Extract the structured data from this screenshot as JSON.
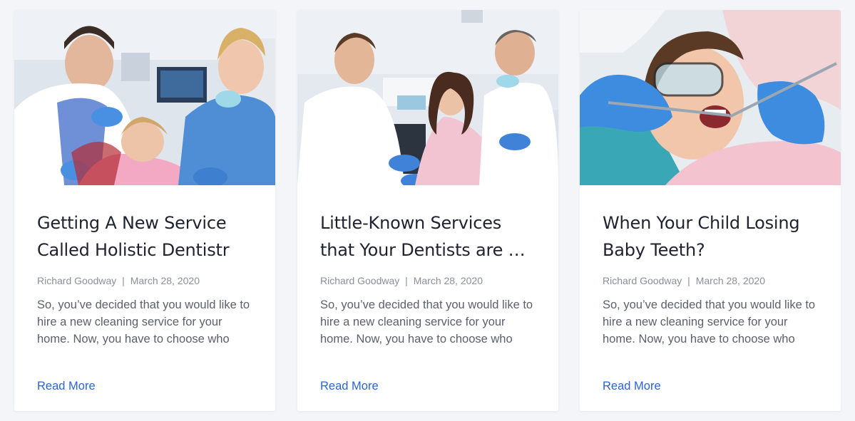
{
  "posts": [
    {
      "title": "Getting A New Service Called Holistic Dentistr",
      "author": "Richard Goodway",
      "date": "March 28, 2020",
      "excerpt": "So, you’ve decided that you would like to hire a new cleaning service for your home. Now, you have to choose who",
      "read_more": "Read More"
    },
    {
      "title": "Little-Known Services that Your Dentists are …",
      "author": "Richard Goodway",
      "date": "March 28, 2020",
      "excerpt": "So, you’ve decided that you would like to hire a new cleaning service for your home. Now, you have to choose who",
      "read_more": "Read More"
    },
    {
      "title": "When Your Child Losing Baby Teeth?",
      "author": "Richard Goodway",
      "date": "March 28, 2020",
      "excerpt": "So, you’ve decided that you would like to hire a new cleaning service for your home. Now, you have to choose who",
      "read_more": "Read More"
    }
  ],
  "meta_separator": "|",
  "colors": {
    "page_background": "#f3f5f8",
    "card_background": "#ffffff",
    "title": "#1f2330",
    "meta": "#8a8f98",
    "excerpt": "#5b616b",
    "link": "#2b64d3"
  }
}
